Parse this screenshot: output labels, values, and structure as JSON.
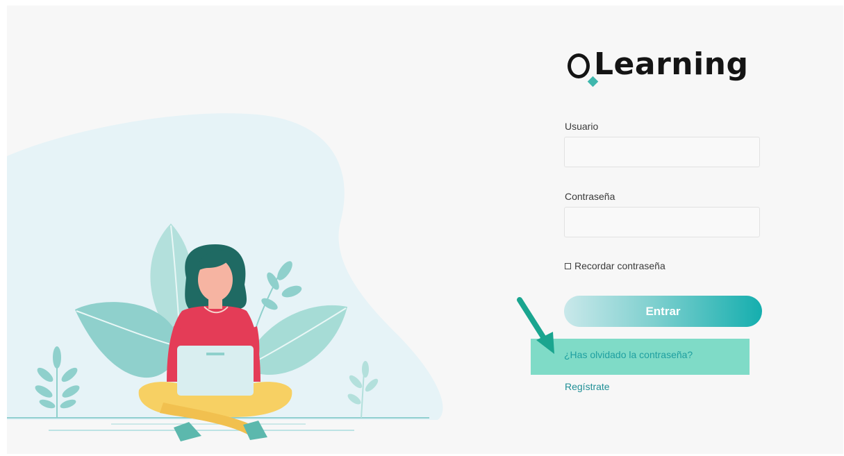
{
  "brand": {
    "name": "Learning",
    "logo_icon": "o-ring-diamond-logo-icon",
    "accent_color": "#3fb7ad"
  },
  "login_form": {
    "username_label": "Usuario",
    "username_value": "",
    "password_label": "Contraseña",
    "password_value": "",
    "remember_label": "Recordar contraseña",
    "remember_checked": false,
    "submit_label": "Entrar",
    "forgot_password_link": "¿Has olvidado la contraseña?",
    "register_link": "Regístrate"
  },
  "annotation": {
    "highlight_color": "#7fdbc7",
    "arrow_color": "#1aa58f",
    "arrow_icon": "arrow-down-right-icon"
  },
  "illustration": {
    "subject": "woman-with-laptop-illustration",
    "colors": {
      "blob": "#e6f3f7",
      "leaves": "#8fd0cc",
      "sweater": "#e43c57",
      "pants": "#f7d063",
      "hair": "#1f6a63",
      "laptop": "#d9eef0"
    }
  }
}
